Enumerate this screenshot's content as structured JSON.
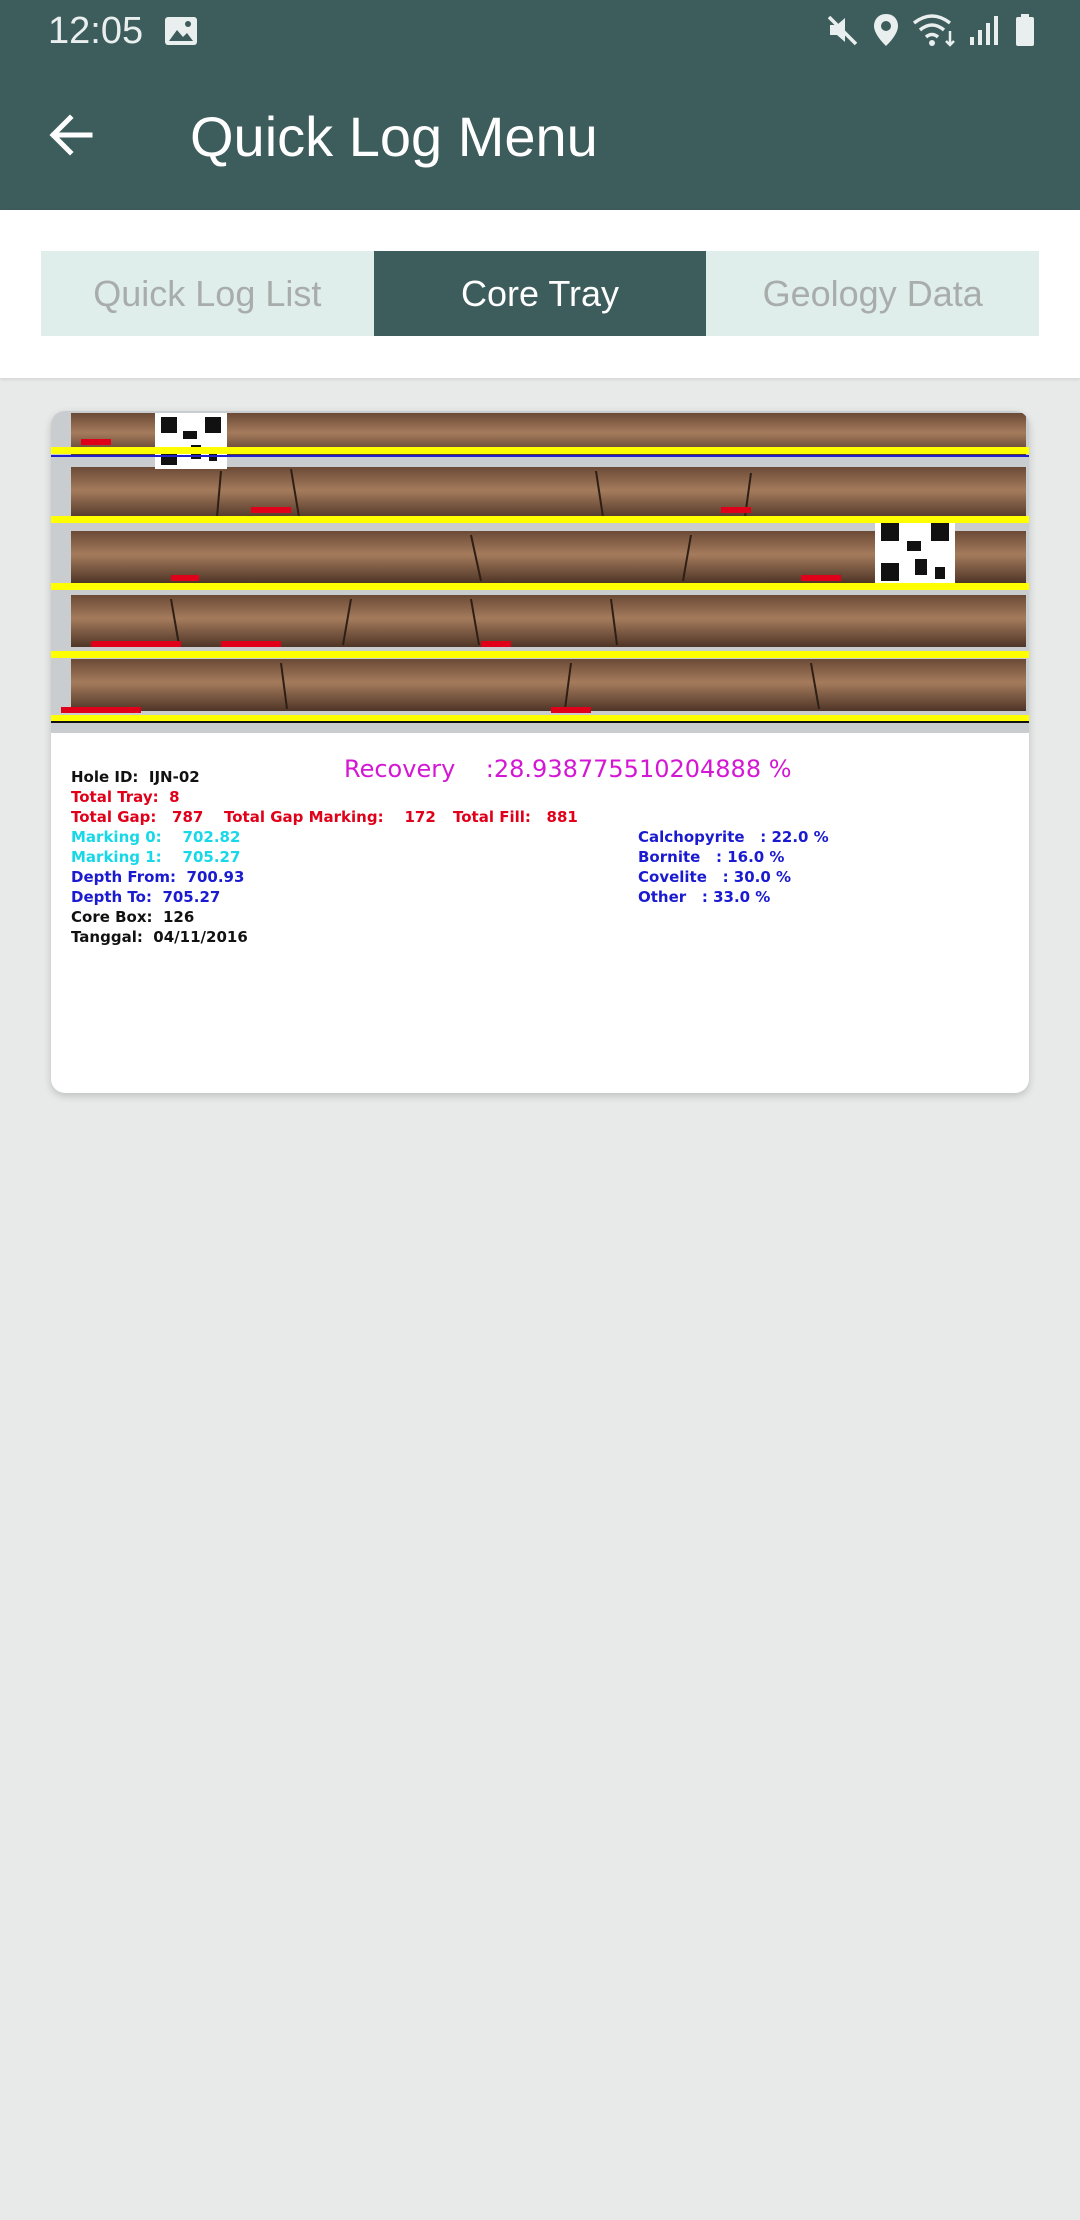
{
  "status_bar": {
    "time": "12:05",
    "icons": [
      "image-icon",
      "mute-icon",
      "location-icon",
      "wifi-icon",
      "signal-icon",
      "battery-icon"
    ]
  },
  "app_bar": {
    "title": "Quick Log Menu",
    "back_icon": "arrow-left-icon"
  },
  "tabs": [
    {
      "label": "Quick Log List",
      "active": false
    },
    {
      "label": "Core Tray",
      "active": true
    },
    {
      "label": "Geology Data",
      "active": false
    }
  ],
  "core_tray": {
    "recovery_label": "Recovery",
    "recovery_value": ":28.938775510204888 %",
    "hole_id_label": "Hole ID:",
    "hole_id": "IJN-02",
    "total_tray_label": "Total Tray:",
    "total_tray": "8",
    "total_gap_label": "Total Gap:",
    "total_gap": "787",
    "total_gap_marking_label": "Total Gap Marking:",
    "total_gap_marking": "172",
    "total_fill_label": "Total Fill:",
    "total_fill": "881",
    "marking0_label": "Marking 0:",
    "marking0": "702.82",
    "marking1_label": "Marking 1:",
    "marking1": "705.27",
    "depth_from_label": "Depth From:",
    "depth_from": "700.93",
    "depth_to_label": "Depth To:",
    "depth_to": "705.27",
    "core_box_label": "Core Box:",
    "core_box": "126",
    "tanggal_label": "Tanggal:",
    "tanggal": "04/11/2016",
    "minerals": [
      {
        "name": "Calchopyrite",
        "value": ": 22.0 %"
      },
      {
        "name": "Bornite",
        "value": ": 16.0 %"
      },
      {
        "name": "Covelite",
        "value": ": 30.0 %"
      },
      {
        "name": "Other",
        "value": ": 33.0 %"
      }
    ]
  },
  "colors": {
    "app_bar": "#3d5c5c",
    "tab_active": "#3d5c5c",
    "tab_inactive": "#dfeeea",
    "background": "#e8eae9",
    "marking_line": "#ffff00"
  }
}
